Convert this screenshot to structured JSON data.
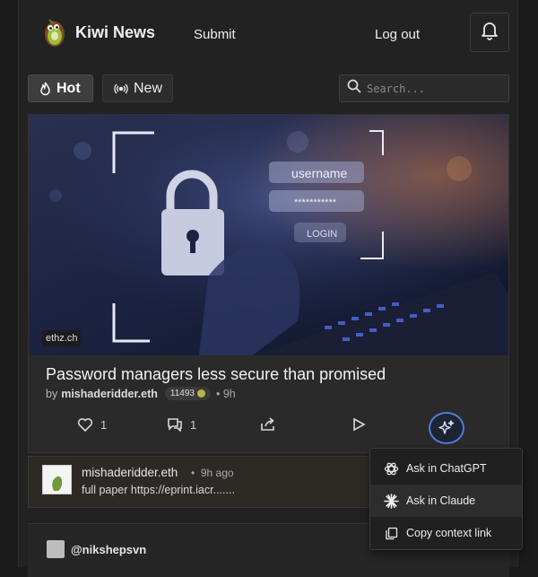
{
  "header": {
    "brand": "Kiwi News",
    "submit_label": "Submit",
    "logout_label": "Log out"
  },
  "tabs": {
    "hot_label": "Hot",
    "new_label": "New"
  },
  "search": {
    "placeholder": "Search..."
  },
  "story": {
    "domain": "ethz.ch",
    "title": "Password managers less secure than promised",
    "by_prefix": "by",
    "author": "mishaderidder.eth",
    "karma": "11493",
    "age": "9h",
    "likes": "1",
    "comments": "1",
    "hero_text": {
      "username": "username",
      "password": "***********",
      "login": "LOGIN"
    }
  },
  "comment": {
    "author": "mishaderidder.eth",
    "age": "9h ago",
    "text": "full paper https://eprint.iacr......."
  },
  "next_story": {
    "user": "@nikshepsvn"
  },
  "ai_menu": {
    "items": [
      {
        "label": "Ask in ChatGPT",
        "icon": "chatgpt-icon"
      },
      {
        "label": "Ask in Claude",
        "icon": "claude-icon"
      },
      {
        "label": "Copy context link",
        "icon": "copy-icon"
      }
    ]
  },
  "colors": {
    "accent": "#4d7fd6",
    "background": "#222222"
  }
}
